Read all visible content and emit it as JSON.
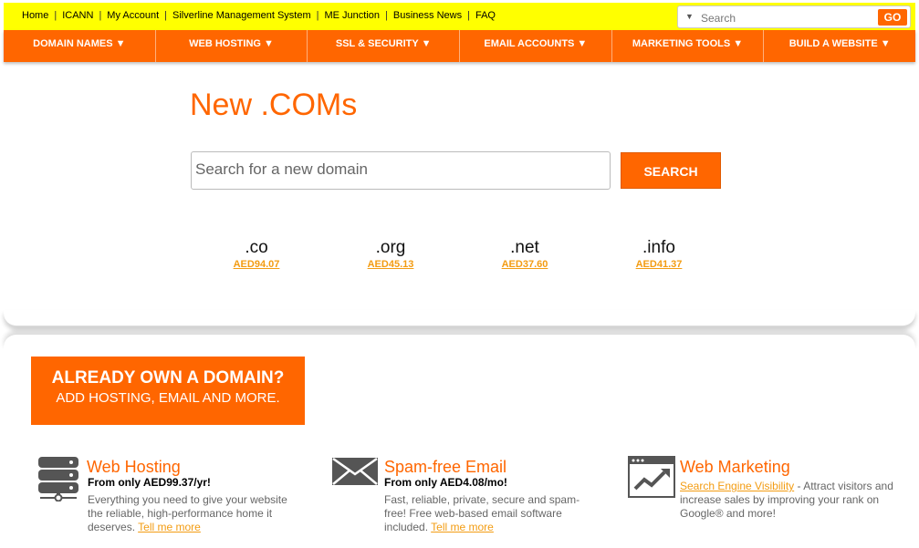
{
  "topbar": {
    "links": [
      "Home",
      "ICANN",
      "My Account",
      "Silverline Management System",
      "ME Junction",
      "Business News",
      "FAQ"
    ],
    "search_placeholder": "Search",
    "go_label": "GO"
  },
  "nav": {
    "items": [
      "DOMAIN NAMES ▼",
      "WEB HOSTING ▼",
      "SSL & SECURITY ▼",
      "EMAIL ACCOUNTS ▼",
      "MARKETING TOOLS ▼",
      "BUILD A WEBSITE ▼"
    ]
  },
  "hero": {
    "title": "New .COMs",
    "input_placeholder": "Search for a new domain",
    "search_label": "SEARCH",
    "tlds": [
      {
        "name": ".co",
        "price": "AED94.07"
      },
      {
        "name": ".org",
        "price": "AED45.13"
      },
      {
        "name": ".net",
        "price": "AED37.60"
      },
      {
        "name": ".info",
        "price": "AED41.37"
      }
    ]
  },
  "own_domain": {
    "line1": "ALREADY OWN A DOMAIN?",
    "line2": "ADD HOSTING, EMAIL AND MORE."
  },
  "features": [
    {
      "icon": "server-icon",
      "title": "Web Hosting",
      "price": "From only AED99.37/yr!",
      "desc": "Everything you need to give your website the reliable, high-performance home it deserves.",
      "link": "Tell me more"
    },
    {
      "icon": "envelope-icon",
      "title": "Spam-free Email",
      "price": "From only AED4.08/mo!",
      "desc": "Fast, reliable, private, secure and spam-free! Free web-based email software included.",
      "link": "Tell me more"
    },
    {
      "icon": "chart-trend-icon",
      "title": "Web Marketing",
      "link_first": "Search Engine Visibility",
      "desc": " - Attract visitors and increase sales by improving your rank on Google® and more!"
    }
  ],
  "colors": {
    "accent": "#ff6600",
    "topbar": "#ffff00",
    "link": "#f39c12"
  }
}
